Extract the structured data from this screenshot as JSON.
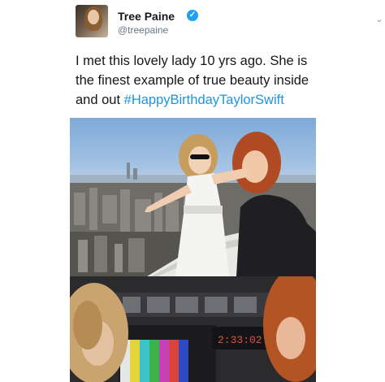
{
  "tweet": {
    "display_name": "Tree Paine",
    "handle": "@treepaine",
    "text_part1": "I met this lovely lady 10 yrs ago. She is the finest example of true beauty inside and out ",
    "hashtag": "#HappyBirthdayTaylorSwift"
  },
  "media": {
    "clock_display": "2:33:02"
  },
  "icons": {
    "verified": "verified-badge-icon",
    "menu": "chevron-down-icon"
  },
  "colors": {
    "hashtag": "#1b95e0",
    "verified": "#1da1f2",
    "handle": "#657786"
  }
}
